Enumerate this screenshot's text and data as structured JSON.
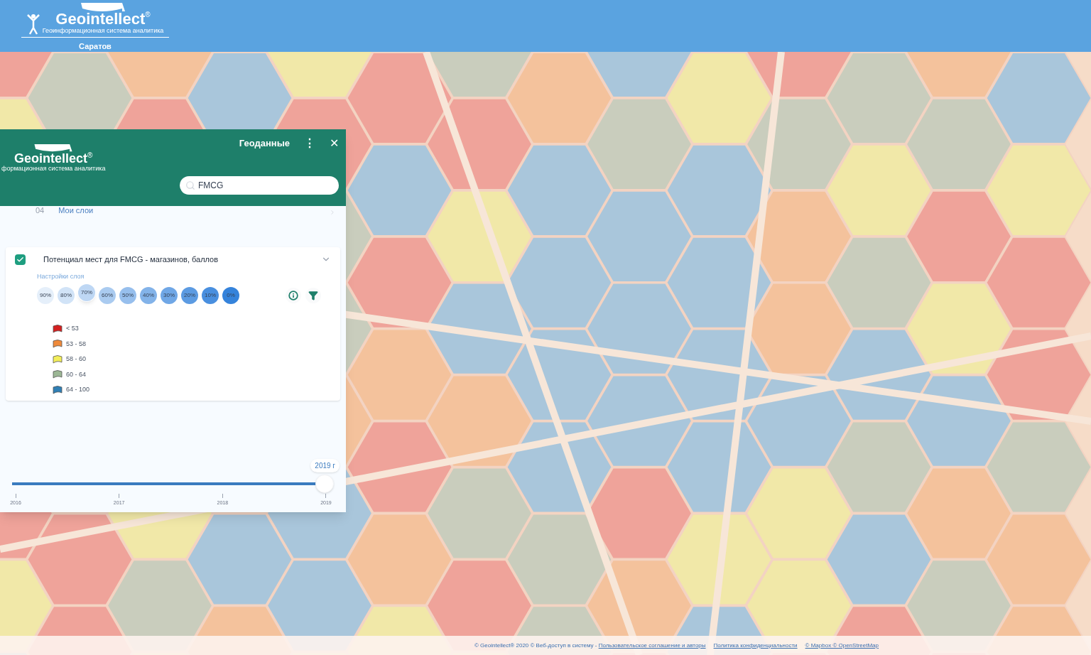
{
  "header": {
    "brand": "Geointellect",
    "registered": "®",
    "tagline": "Геоинформационная система аналитика",
    "city": "Саратов"
  },
  "panel": {
    "brand": "Geointellect",
    "registered": "®",
    "tagline": "формационная система аналитика",
    "title": "Геоданные",
    "menu": "⋮",
    "close": "✕",
    "search": {
      "value": "FMCG"
    },
    "section": {
      "count": "04",
      "label": "Мои слои"
    },
    "layer": {
      "checked": true,
      "name": "Потенциал мест для FMCG - магазинов, баллов",
      "expanded": true,
      "settings_label": "Настройки слоя",
      "opacity": [
        {
          "label": "90%",
          "selected": false
        },
        {
          "label": "80%",
          "selected": false
        },
        {
          "label": "70%",
          "selected": true
        },
        {
          "label": "60%",
          "selected": false
        },
        {
          "label": "50%",
          "selected": false
        },
        {
          "label": "40%",
          "selected": false
        },
        {
          "label": "30%",
          "selected": false
        },
        {
          "label": "20%",
          "selected": false
        },
        {
          "label": "10%",
          "selected": false
        },
        {
          "label": "0%",
          "selected": false
        }
      ],
      "legend": [
        {
          "label": "< 53",
          "color": "#d42020"
        },
        {
          "label": "53 - 58",
          "color": "#ef8a3a"
        },
        {
          "label": "58 - 60",
          "color": "#f3ee5a"
        },
        {
          "label": "60 - 64",
          "color": "#9cb795"
        },
        {
          "label": "64 - 100",
          "color": "#2f7fb5"
        }
      ]
    },
    "timeline": {
      "value": "2019 г",
      "level": 1,
      "ticks": [
        "2016",
        "2017",
        "2018",
        "2019"
      ]
    }
  },
  "footer": [
    {
      "kind": "text",
      "text": "© Geointellect® 2020 © Веб-доступ в систему - "
    },
    {
      "kind": "link",
      "text": "Пользовательское соглашение и авторы"
    },
    {
      "kind": "link",
      "text": "Политика конфиденциальности"
    },
    {
      "kind": "link",
      "text": "© Mapbox © OpenStreetMap"
    }
  ]
}
